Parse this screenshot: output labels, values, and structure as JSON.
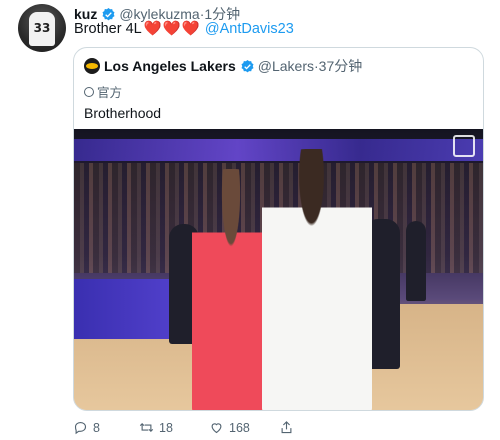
{
  "tweet": {
    "author": {
      "name": "kuz",
      "handle": "@kylekuzma",
      "time": "·1分钟",
      "avatar_number": "33"
    },
    "text": "Brother 4L",
    "hearts": "❤️❤️❤️",
    "mention": "@AntDavis23"
  },
  "quote": {
    "author": {
      "name": "Los Angeles Lakers",
      "handle": "@Lakers",
      "time": "·37分钟"
    },
    "badge": "官方",
    "text": "Brotherhood"
  },
  "actions": {
    "reply_count": "8",
    "retweet_count": "18",
    "like_count": "168"
  },
  "colors": {
    "accent": "#1d9bf0",
    "heart": "#e0245e",
    "muted": "#536471"
  }
}
